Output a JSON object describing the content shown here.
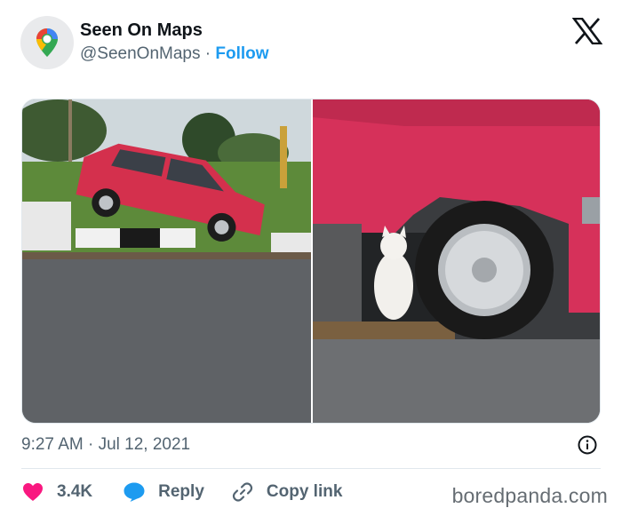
{
  "header": {
    "display_name": "Seen On Maps",
    "handle": "@SeenOnMaps",
    "separator": "·",
    "follow_label": "Follow",
    "avatar_icon": "google-maps-pin-icon",
    "platform_icon": "x-logo-icon"
  },
  "media": {
    "count": 2
  },
  "footer": {
    "timestamp": "9:27 AM · Jul 12, 2021",
    "info_icon": "info-icon"
  },
  "actions": {
    "like_count": "3.4K",
    "reply_label": "Reply",
    "copy_link_label": "Copy link"
  },
  "watermark": "boredpanda.com",
  "colors": {
    "accent": "#1d9bf0",
    "like": "#f91880",
    "text_secondary": "#536471"
  }
}
